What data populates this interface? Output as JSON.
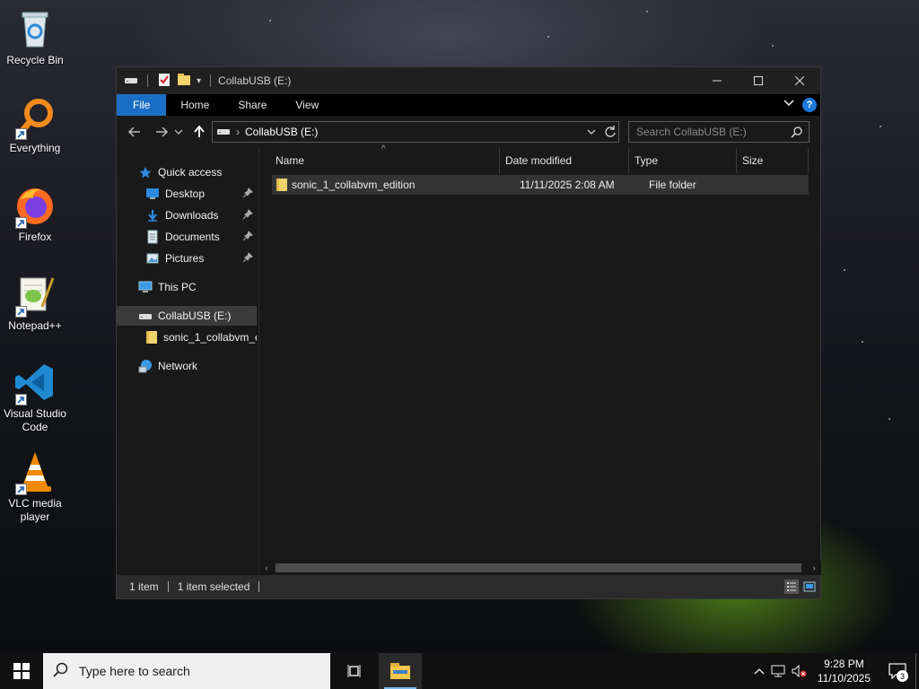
{
  "desktop": {
    "icons": [
      {
        "label": "Recycle Bin",
        "icon": "recycle-bin-icon"
      },
      {
        "label": "Everything",
        "icon": "everything-search-icon"
      },
      {
        "label": "Firefox",
        "icon": "firefox-icon"
      },
      {
        "label": "Notepad++",
        "icon": "notepad-plus-plus-icon"
      },
      {
        "label": "Visual Studio Code",
        "icon": "vscode-icon"
      },
      {
        "label": "VLC media player",
        "icon": "vlc-icon"
      }
    ]
  },
  "window": {
    "title": "CollabUSB (E:)",
    "ribbon_tabs": [
      "File",
      "Home",
      "Share",
      "View"
    ],
    "address_path": "CollabUSB (E:)",
    "search_placeholder": "Search CollabUSB (E:)",
    "nav": {
      "quick_access": "Quick access",
      "desktop": "Desktop",
      "downloads": "Downloads",
      "documents": "Documents",
      "pictures": "Pictures",
      "this_pc": "This PC",
      "collabusb": "CollabUSB (E:)",
      "sub_folder": "sonic_1_collabvm_edition",
      "network": "Network"
    },
    "columns": [
      "Name",
      "Date modified",
      "Type",
      "Size"
    ],
    "files": [
      {
        "name": "sonic_1_collabvm_edition",
        "date_modified": "11/11/2025 2:08 AM",
        "type": "File folder",
        "size": ""
      }
    ],
    "status": {
      "item_count": "1 item",
      "selected": "1 item selected"
    }
  },
  "taskbar": {
    "search_placeholder": "Type here to search",
    "time": "9:28 PM",
    "date": "11/10/2025",
    "notification_count": "3"
  },
  "colors": {
    "accent": "#1a6fc4",
    "window_bg": "#191919",
    "selected_row": "#333333"
  }
}
